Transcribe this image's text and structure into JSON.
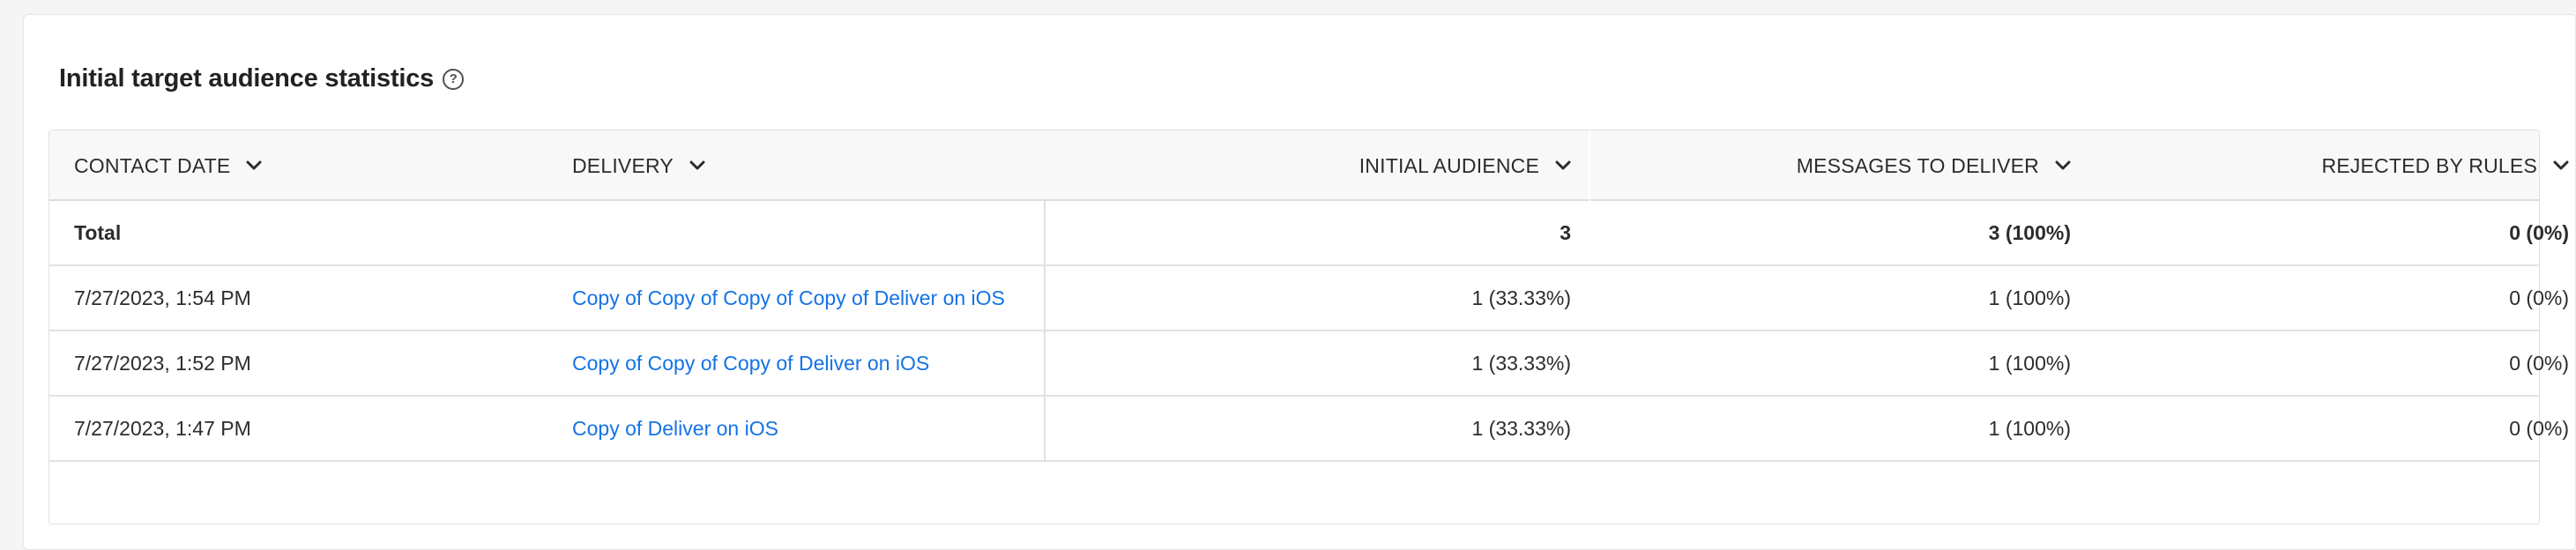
{
  "panel": {
    "title": "Initial target audience statistics",
    "help_icon": "?"
  },
  "table": {
    "columns": [
      {
        "label": "CONTACT DATE"
      },
      {
        "label": "DELIVERY"
      },
      {
        "label": "INITIAL AUDIENCE"
      },
      {
        "label": "MESSAGES TO DELIVER"
      },
      {
        "label": "REJECTED BY RULES"
      }
    ],
    "total": {
      "label": "Total",
      "delivery": "",
      "initial_audience": "3",
      "messages_to_deliver": "3 (100%)",
      "rejected_by_rules": "0 (0%)"
    },
    "rows": [
      {
        "contact_date": "7/27/2023, 1:54 PM",
        "delivery": "Copy of Copy of Copy of Copy of Deliver on iOS",
        "initial_audience": "1 (33.33%)",
        "messages_to_deliver": "1 (100%)",
        "rejected_by_rules": "0 (0%)"
      },
      {
        "contact_date": "7/27/2023, 1:52 PM",
        "delivery": "Copy of Copy of Copy of Deliver on iOS",
        "initial_audience": "1 (33.33%)",
        "messages_to_deliver": "1 (100%)",
        "rejected_by_rules": "0 (0%)"
      },
      {
        "contact_date": "7/27/2023, 1:47 PM",
        "delivery": "Copy of Deliver on iOS",
        "initial_audience": "1 (33.33%)",
        "messages_to_deliver": "1 (100%)",
        "rejected_by_rules": "0 (0%)"
      }
    ]
  },
  "colors": {
    "link": "#1473e6",
    "header_bg": "#f8f8f8",
    "border": "#e2e2e2"
  },
  "icons": {
    "sort": "chevron-down-icon",
    "help": "help-circle-icon"
  }
}
